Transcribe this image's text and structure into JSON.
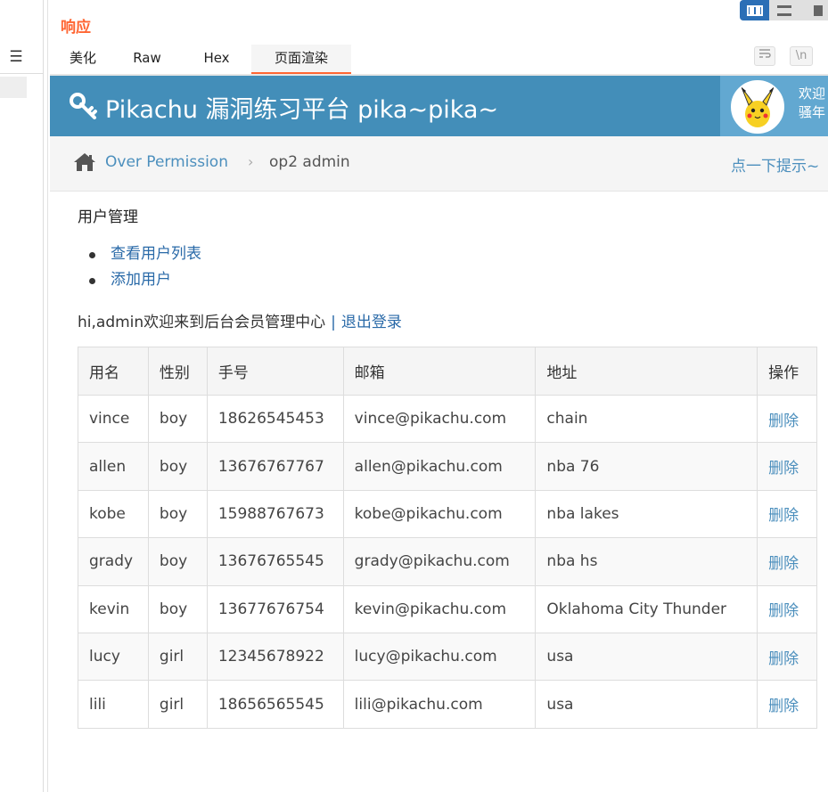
{
  "panel": {
    "title": "响应",
    "tabs": [
      "美化",
      "Raw",
      "Hex",
      "页面渲染"
    ],
    "active_tab": "页面渲染",
    "wrap_icon": "wrap-lines-icon",
    "newline_label": "\\n"
  },
  "left": {
    "menu_glyph": "☰"
  },
  "page": {
    "brand": "Pikachu 漏洞练习平台 pika~pika~",
    "user_line1": "欢迎",
    "user_line2": "骚年",
    "breadcrumb": {
      "link": "Over Permission",
      "sep": "›",
      "current": "op2 admin"
    },
    "hint": "点一下提示~",
    "section_title": "用户管理",
    "links": [
      "查看用户列表",
      "添加用户"
    ],
    "greeting": "hi,admin欢迎来到后台会员管理中心",
    "pipe": "|",
    "logout": "退出登录",
    "table": {
      "headers": [
        "用名",
        "性别",
        "手号",
        "邮箱",
        "地址",
        "操作"
      ],
      "rows": [
        [
          "vince",
          "boy",
          "18626545453",
          "vince@pikachu.com",
          "chain",
          "删除"
        ],
        [
          "allen",
          "boy",
          "13676767767",
          "allen@pikachu.com",
          "nba 76",
          "删除"
        ],
        [
          "kobe",
          "boy",
          "15988767673",
          "kobe@pikachu.com",
          "nba lakes",
          "删除"
        ],
        [
          "grady",
          "boy",
          "13676765545",
          "grady@pikachu.com",
          "nba hs",
          "删除"
        ],
        [
          "kevin",
          "boy",
          "13677676754",
          "kevin@pikachu.com",
          "Oklahoma City Thunder",
          "删除"
        ],
        [
          "lucy",
          "girl",
          "12345678922",
          "lucy@pikachu.com",
          "usa",
          "删除"
        ],
        [
          "lili",
          "girl",
          "18656565545",
          "lili@pikachu.com",
          "usa",
          "删除"
        ]
      ]
    }
  },
  "colors": {
    "accent": "#ff6633",
    "banner": "#438eb9",
    "link": "#4c8fbd",
    "toggle_active": "#2b6fb6"
  }
}
